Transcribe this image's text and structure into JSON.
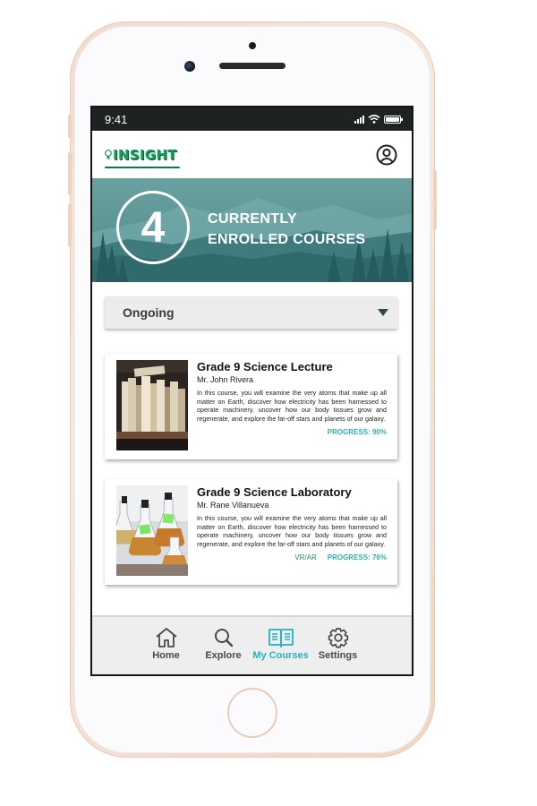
{
  "status_bar": {
    "time": "9:41"
  },
  "header": {
    "logo_text": "INSIGHT",
    "profile_icon": "user-circle-icon"
  },
  "hero": {
    "count": "4",
    "line1": "CURRENTLY",
    "line2": "ENROLLED COURSES"
  },
  "filter": {
    "selected": "Ongoing"
  },
  "courses": [
    {
      "title": "Grade 9 Science Lecture",
      "teacher": "Mr. John Rivera",
      "description": "In this course, you will examine the very atoms that make up all matter on Earth, discover how electricity has been harnessed to operate machinery, uncover how our body tissues grow and regenerate, and explore the far-off stars and planets of our galaxy.",
      "tag": "",
      "progress_label": "PROGRESS: 90%",
      "progress": 0.9,
      "thumbnail": "books-on-shelf"
    },
    {
      "title": "Grade 9 Science Laboratory",
      "teacher": "Mr. Rane Villanueva",
      "description": "In this course, you will examine the very atoms that make up all matter on Earth, discover how electricity has been harnessed to operate machinery, uncover how our body tissues grow and regenerate, and explore the far-off stars and planets of our galaxy.",
      "tag": "VR/AR",
      "progress_label": "PROGRESS: 76%",
      "progress": 0.76,
      "thumbnail": "lab-flasks"
    }
  ],
  "nav": {
    "home": "Home",
    "explore": "Explore",
    "my_courses": "My Courses",
    "settings": "Settings",
    "active": "my_courses"
  },
  "colors": {
    "accent": "#1fb3c1",
    "progress": "#2bb3ae",
    "brand_green": "#169f5b",
    "hero_teal": "#5b9697"
  }
}
